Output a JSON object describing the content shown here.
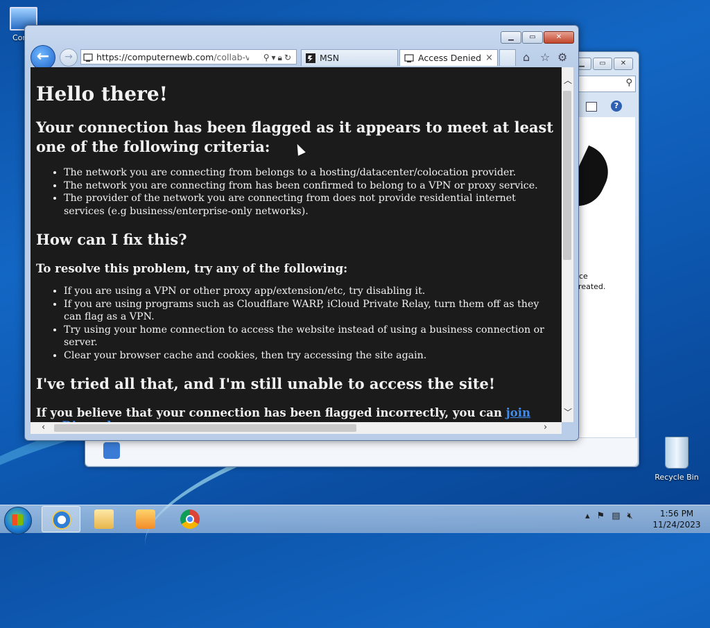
{
  "desktop": {
    "computer_label": "Comp",
    "recycle_label": "Recycle Bin"
  },
  "bg_window": {
    "text_line1": "nce",
    "text_line2": "created."
  },
  "browser": {
    "address": {
      "host": "https://computernewb.com",
      "path": "/collab-vm/c"
    },
    "tabs": [
      {
        "label": "MSN",
        "icon": "msn-icon"
      },
      {
        "label": "Access Denied",
        "icon": "page-icon",
        "close": "×"
      }
    ],
    "commands": {
      "home": "⌂",
      "favorites": "☆",
      "tools": "⚙"
    }
  },
  "page": {
    "h1": "Hello there!",
    "h2_flagged": "Your connection has been flagged as it appears to meet at least one of the following criteria:",
    "criteria": [
      "The network you are connecting from belongs to a hosting/datacenter/colocation provider.",
      "The network you are connecting from has been confirmed to belong to a VPN or proxy service.",
      "The provider of the network you are connecting from does not provide residential internet services (e.g business/enterprise-only networks)."
    ],
    "h2_fix": "How can I fix this?",
    "h3_resolve": "To resolve this problem, try any of the following:",
    "fixes": [
      "If you are using a VPN or other proxy app/extension/etc, try disabling it.",
      "If you are using programs such as Cloudflare WARP, iCloud Private Relay, turn them off as they can flag as a VPN.",
      "Try using your home connection to access the website instead of using a business connection or server.",
      "Clear your browser cache and cookies, then try accessing the site again."
    ],
    "h2_tried": "I've tried all that, and I'm still unable to access the site!",
    "last_text": "If you believe that your connection has been flagged incorrectly, you can",
    "last_link": "join our Discord"
  },
  "taskbar": {
    "time": "1:56 PM",
    "date": "11/24/2023"
  }
}
